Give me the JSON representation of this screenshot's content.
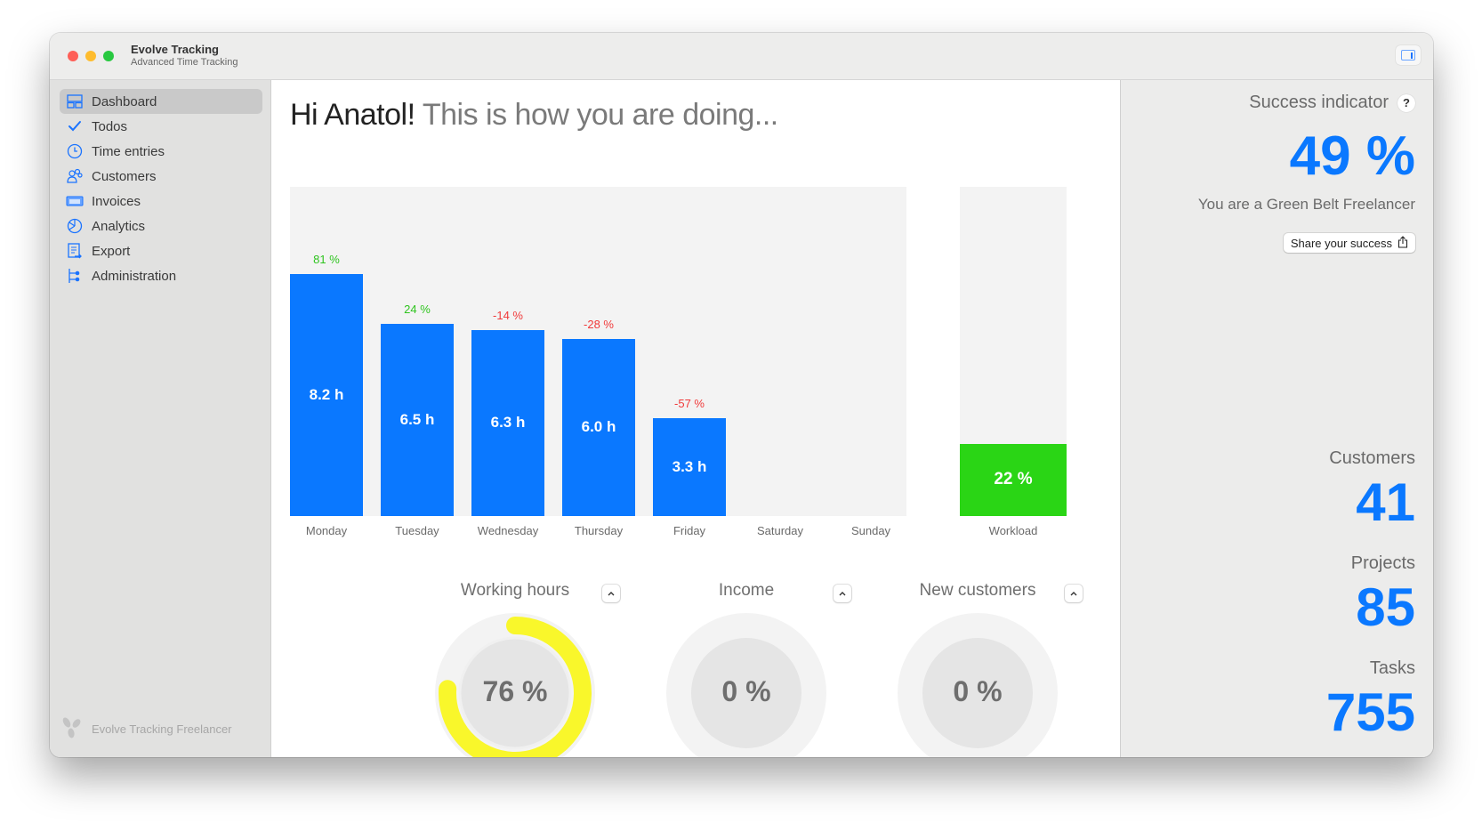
{
  "window": {
    "title": "Evolve Tracking",
    "subtitle": "Advanced Time Tracking"
  },
  "sidebar": {
    "items": [
      {
        "label": "Dashboard",
        "icon": "dashboard-icon",
        "active": true
      },
      {
        "label": "Todos",
        "icon": "checkmark-icon",
        "active": false
      },
      {
        "label": "Time entries",
        "icon": "clock-icon",
        "active": false
      },
      {
        "label": "Customers",
        "icon": "customers-icon",
        "active": false
      },
      {
        "label": "Invoices",
        "icon": "invoice-icon",
        "active": false
      },
      {
        "label": "Analytics",
        "icon": "analytics-icon",
        "active": false
      },
      {
        "label": "Export",
        "icon": "export-icon",
        "active": false
      },
      {
        "label": "Administration",
        "icon": "administration-icon",
        "active": false
      }
    ],
    "footer": "Evolve Tracking Freelancer"
  },
  "main": {
    "greeting_name": "Hi Anatol!",
    "greeting_rest": "This is how you are doing..."
  },
  "chart_data": [
    {
      "type": "bar",
      "title": "",
      "categories": [
        "Monday",
        "Tuesday",
        "Wednesday",
        "Thursday",
        "Friday",
        "Saturday",
        "Sunday"
      ],
      "values": [
        8.2,
        6.5,
        6.3,
        6.0,
        3.3,
        null,
        null
      ],
      "value_labels": [
        "8.2 h",
        "6.5 h",
        "6.3 h",
        "6.0 h",
        "3.3 h",
        "",
        ""
      ],
      "change_labels": [
        "81 %",
        "24 %",
        "-14 %",
        "-28 %",
        "-57 %",
        "",
        ""
      ],
      "change_values": [
        81,
        24,
        -14,
        -28,
        -57,
        null,
        null
      ],
      "unit": "h",
      "ylim": [
        0,
        11.15
      ],
      "grid": false,
      "colors": {
        "bar": "#0a78ff",
        "positive": "#2fc41f",
        "negative": "#f03a3a",
        "background": "#f3f3f3"
      }
    },
    {
      "type": "bar",
      "title": "",
      "categories": [
        "Workload"
      ],
      "values": [
        22
      ],
      "value_labels": [
        "22 %"
      ],
      "ylim": [
        0,
        100
      ],
      "colors": {
        "bar": "#2ad515",
        "background": "#f3f3f3"
      }
    }
  ],
  "gauges": [
    {
      "title": "Working hours",
      "value": 76,
      "label": "76 %",
      "color": "#f9f72b"
    },
    {
      "title": "Income",
      "value": 0,
      "label": "0 %",
      "color": "#f9f72b"
    },
    {
      "title": "New customers",
      "value": 0,
      "label": "0 %",
      "color": "#f9f72b"
    }
  ],
  "right_panel": {
    "success_label": "Success indicator",
    "help": "?",
    "success_value": "49 %",
    "belt_text": "You are a Green Belt Freelancer",
    "share_label": "Share your success",
    "stats": [
      {
        "label": "Customers",
        "value": "41"
      },
      {
        "label": "Projects",
        "value": "85"
      },
      {
        "label": "Tasks",
        "value": "755"
      }
    ]
  }
}
